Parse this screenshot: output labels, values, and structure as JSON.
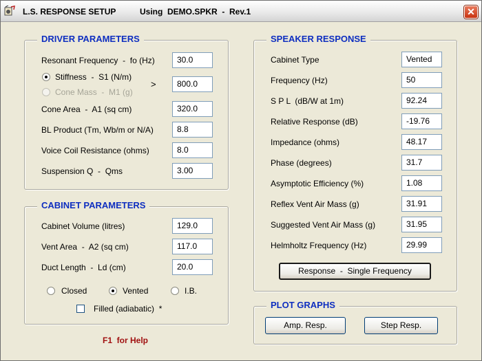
{
  "window": {
    "title": "L.S. RESPONSE SETUP",
    "subtitle": "Using  DEMO.SPKR  -  Rev.1",
    "close_label": "✕"
  },
  "driver": {
    "title": "DRIVER PARAMETERS",
    "resonant_label": "Resonant Frequency  -  fo (Hz)",
    "resonant_value": "30.0",
    "stiffness_label": "Stiffness  -  S1 (N/m)",
    "cone_mass_label": "Cone Mass  -  M1 (g)",
    "arrow": ">",
    "stiffness_value": "800.0",
    "cone_area_label": "Cone Area  -  A1 (sq cm)",
    "cone_area_value": "320.0",
    "bl_label": "BL Product (Tm, Wb/m or N/A)",
    "bl_value": "8.8",
    "vc_label": "Voice Coil Resistance (ohms)",
    "vc_value": "8.0",
    "qms_label": "Suspension Q  -  Qms",
    "qms_value": "3.00"
  },
  "cabinet": {
    "title": "CABINET PARAMETERS",
    "volume_label": "Cabinet Volume (litres)",
    "volume_value": "129.0",
    "vent_area_label": "Vent Area  -  A2 (sq cm)",
    "vent_area_value": "117.0",
    "duct_label": "Duct Length  -  Ld (cm)",
    "duct_value": "20.0",
    "closed_label": "Closed",
    "vented_label": "Vented",
    "ib_label": "I.B.",
    "filled_label": "Filled (adiabatic)  *",
    "selected_type": "Vented"
  },
  "help_text": "F1  for Help",
  "speaker": {
    "title": "SPEAKER RESPONSE",
    "rows": [
      {
        "label": "Cabinet Type",
        "value": "Vented"
      },
      {
        "label": "Frequency (Hz)",
        "value": "50"
      },
      {
        "label": "S P L  (dB/W at 1m)",
        "value": "92.24"
      },
      {
        "label": "Relative Response (dB)",
        "value": "-19.76"
      },
      {
        "label": "Impedance (ohms)",
        "value": "48.17"
      },
      {
        "label": "Phase (degrees)",
        "value": "31.7"
      },
      {
        "label": "Asymptotic Efficiency (%)",
        "value": "1.08"
      },
      {
        "label": "Reflex Vent Air Mass (g)",
        "value": "31.91"
      },
      {
        "label": "Suggested Vent Air Mass (g)",
        "value": "31.95"
      },
      {
        "label": "Helmholtz Frequency (Hz)",
        "value": "29.99"
      }
    ],
    "response_button": "Response  -  Single Frequency"
  },
  "plot": {
    "title": "PLOT GRAPHS",
    "amp_button": "Amp. Resp.",
    "step_button": "Step Resp."
  },
  "icons": {
    "app": "speaker-app-icon",
    "close": "close-icon"
  },
  "colors": {
    "group_title": "#0e2ec0",
    "help": "#a01010",
    "close_button": "#c8320f"
  }
}
